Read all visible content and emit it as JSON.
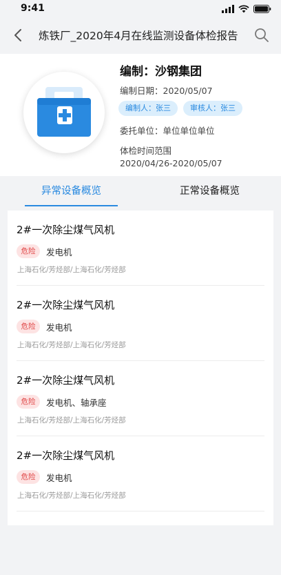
{
  "status_bar": {
    "time": "9:41"
  },
  "nav": {
    "title": "炼铁厂_2020年4月在线监测设备体检报告"
  },
  "report": {
    "org_line": "编制：沙钢集团",
    "date_line": "编制日期：2020/05/07",
    "editor_chip": "编制人：张三",
    "reviewer_chip": "审核人：张三",
    "client_line": "委托单位：单位单位单位",
    "range_label": "体检时间范围",
    "range_value": "2020/04/26-2020/05/07"
  },
  "tabs": [
    {
      "label": "异常设备概览",
      "active": true
    },
    {
      "label": "正常设备概览",
      "active": false
    }
  ],
  "devices": [
    {
      "name": "2#一次除尘煤气风机",
      "risk": "危险",
      "type": "发电机",
      "path": "上海石化/芳烃部/上海石化/芳烃部"
    },
    {
      "name": "2#一次除尘煤气风机",
      "risk": "危险",
      "type": "发电机",
      "path": "上海石化/芳烃部/上海石化/芳烃部"
    },
    {
      "name": "2#一次除尘煤气风机",
      "risk": "危险",
      "type": "发电机、轴承座",
      "path": "上海石化/芳烃部/上海石化/芳烃部"
    },
    {
      "name": "2#一次除尘煤气风机",
      "risk": "危险",
      "type": "发电机",
      "path": "上海石化/芳烃部/上海石化/芳烃部"
    }
  ],
  "colors": {
    "accent": "#2a8ae0",
    "chip_bg": "#dbeefc",
    "risk_text": "#e04848",
    "risk_bg": "#fde3e3",
    "page_bg": "#f2f3f5"
  },
  "icons": [
    "signal-icon",
    "wifi-icon",
    "battery-icon",
    "back-arrow-icon",
    "search-icon",
    "medical-kit-icon"
  ]
}
